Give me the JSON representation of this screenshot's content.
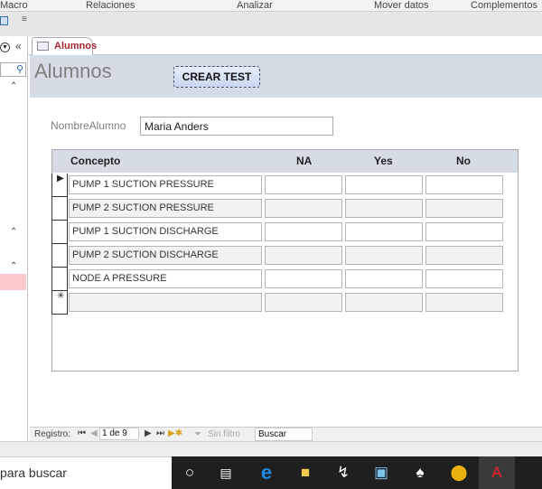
{
  "ribbon": {
    "tabs": [
      "Macro",
      "Relaciones",
      "Analizar",
      "Mover datos",
      "Complementos"
    ]
  },
  "tab": {
    "label": "Alumnos"
  },
  "form": {
    "title": "Alumnos",
    "crear_button": "CREAR TEST",
    "name_label": "NombreAlumno",
    "name_value": "Maria Anders"
  },
  "subform": {
    "headers": [
      "Concepto",
      "NA",
      "Yes",
      "No"
    ],
    "rows": [
      {
        "concepto": "PUMP 1 SUCTION PRESSURE",
        "na": "",
        "yes": "",
        "no": ""
      },
      {
        "concepto": "PUMP 2 SUCTION PRESSURE",
        "na": "",
        "yes": "",
        "no": ""
      },
      {
        "concepto": "PUMP 1 SUCTION DISCHARGE",
        "na": "",
        "yes": "",
        "no": ""
      },
      {
        "concepto": "PUMP 2 SUCTION DISCHARGE",
        "na": "",
        "yes": "",
        "no": ""
      },
      {
        "concepto": "NODE A PRESSURE",
        "na": "",
        "yes": "",
        "no": ""
      },
      {
        "concepto": "",
        "na": "",
        "yes": "",
        "no": ""
      }
    ]
  },
  "navbar": {
    "label": "Registro:",
    "position": "1 de 9",
    "filter": "Sin filtro",
    "search": "Buscar"
  },
  "taskbar": {
    "search_text": "para buscar",
    "icons": [
      "cortana-icon",
      "task-view-icon",
      "edge-icon",
      "file-explorer-icon",
      "app-icon",
      "control-panel-icon",
      "solitaire-icon",
      "chrome-icon",
      "access-icon"
    ]
  }
}
